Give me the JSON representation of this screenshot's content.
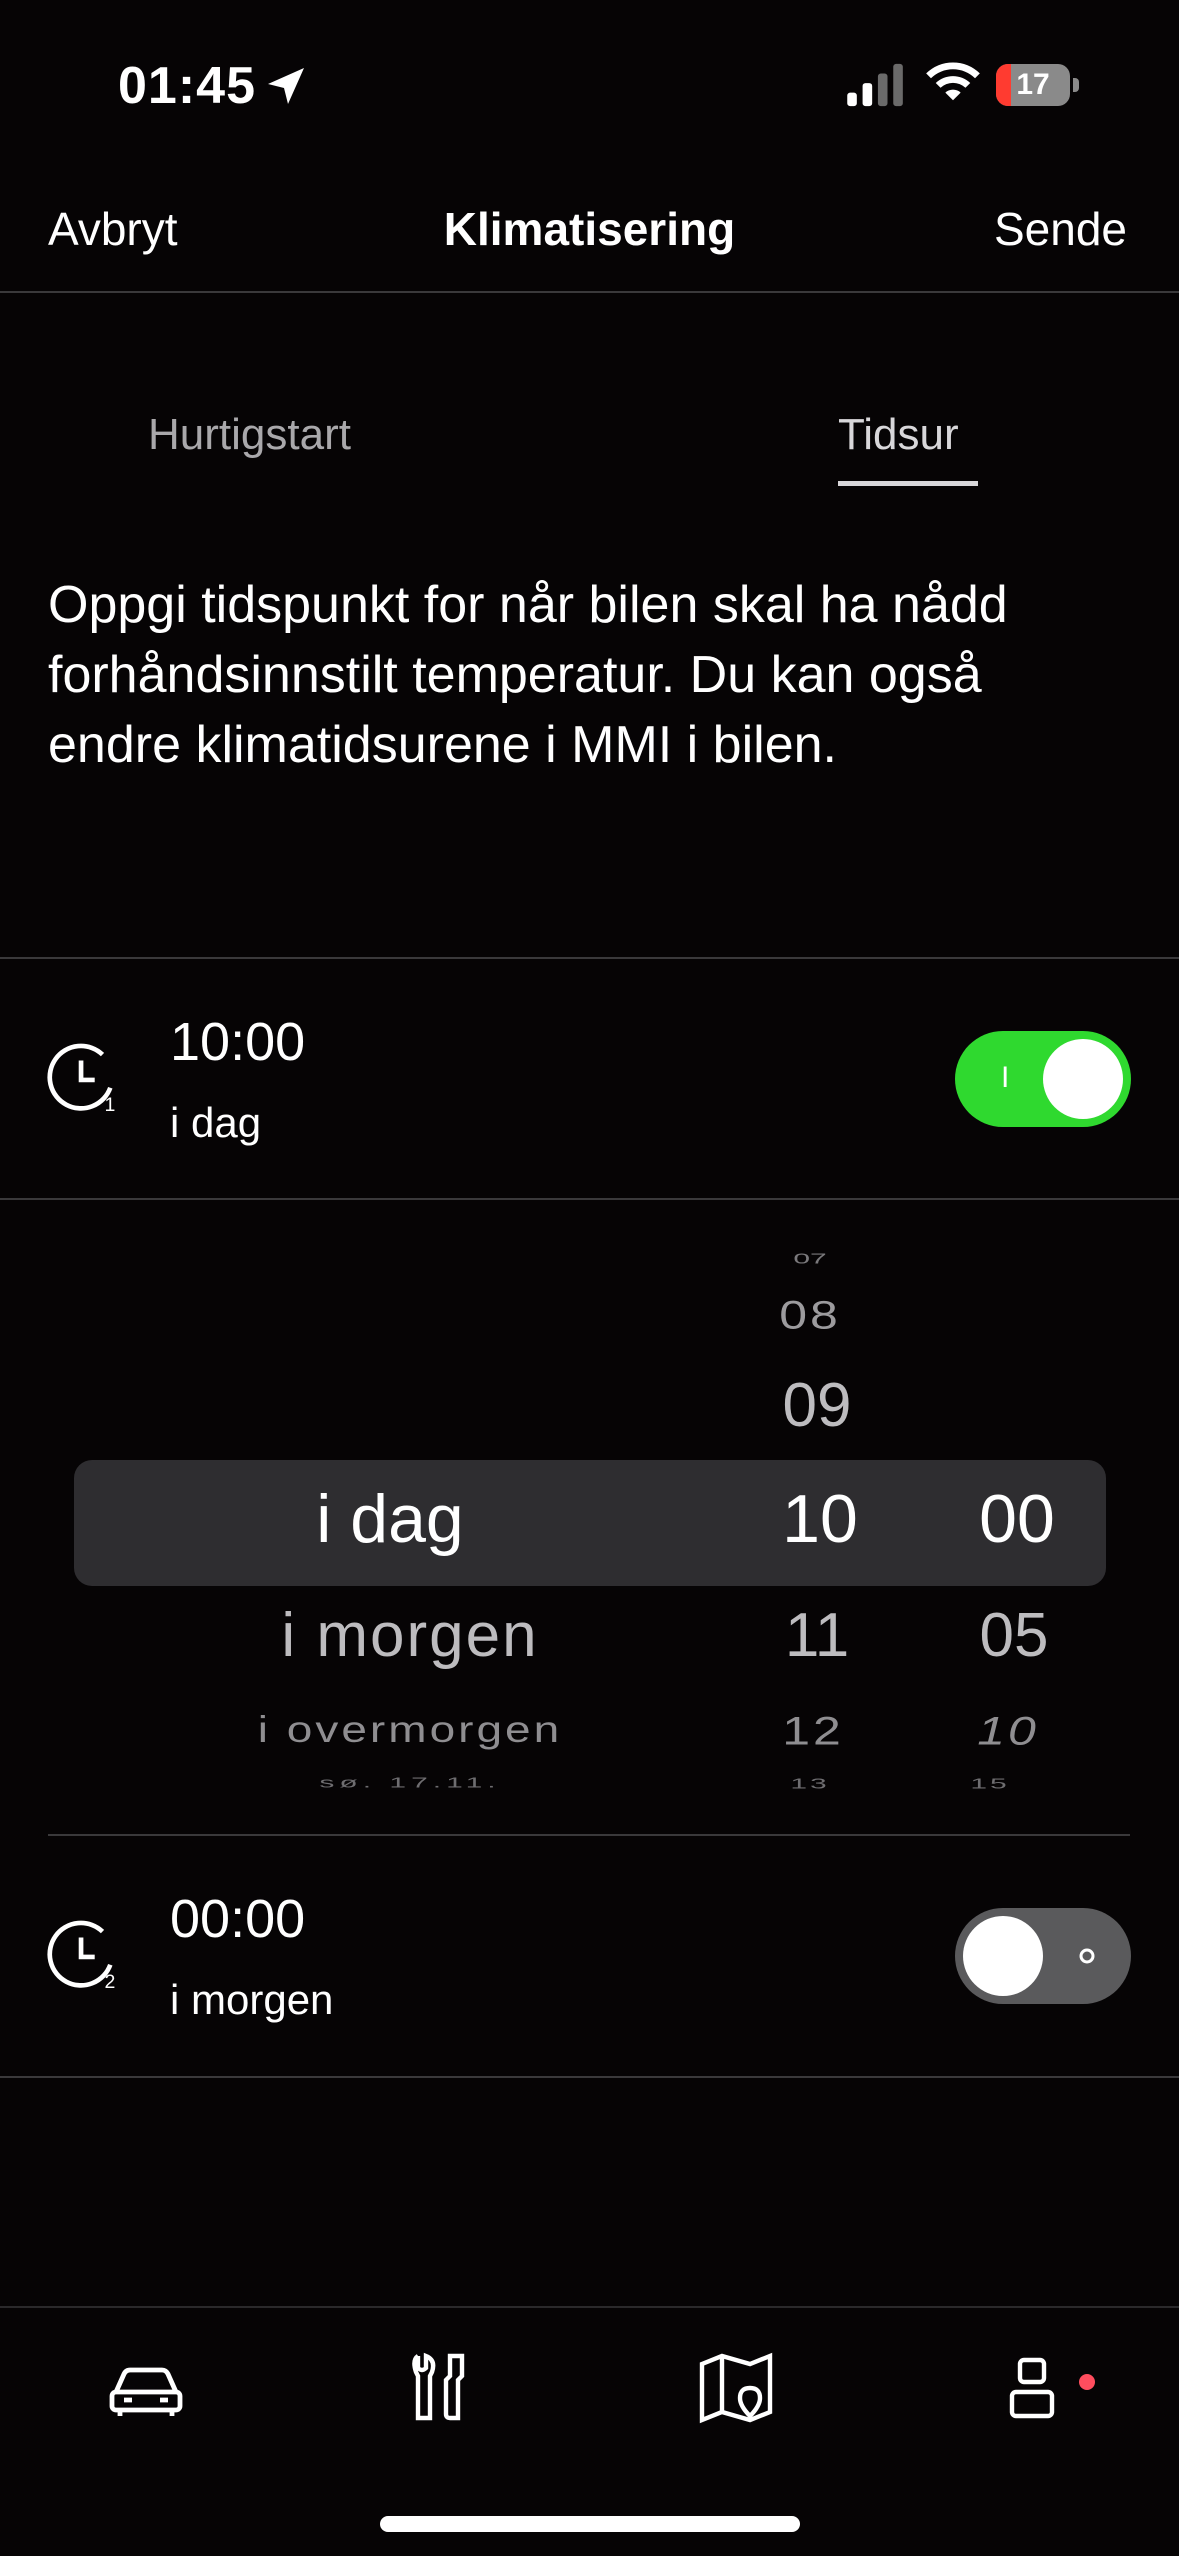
{
  "status_bar": {
    "time": "01:45",
    "battery": "17"
  },
  "header": {
    "cancel": "Avbryt",
    "title": "Klimatisering",
    "send": "Sende"
  },
  "tabs": [
    {
      "label": "Hurtigstart",
      "active": false
    },
    {
      "label": "Tidsur",
      "active": true
    }
  ],
  "description": "Oppgi tidspunkt for når bilen skal ha nådd forhåndsinnstilt temperatur. Du kan også endre klimatidsurene i MMI i bilen.",
  "timers": [
    {
      "index": "1",
      "time": "10:00",
      "day": "i dag",
      "enabled": true,
      "toggle_mark": "I"
    },
    {
      "index": "2",
      "time": "00:00",
      "day": "i morgen",
      "enabled": false,
      "toggle_mark": "O"
    }
  ],
  "picker": {
    "days": [
      "i dag",
      "i morgen",
      "i overmorgen",
      "sø. 17.11."
    ],
    "hours": [
      "07",
      "08",
      "09",
      "10",
      "11",
      "12",
      "13"
    ],
    "minutes": [
      "00",
      "05",
      "10",
      "15"
    ],
    "selected": {
      "day": "i dag",
      "hour": "10",
      "minute": "00"
    }
  },
  "colors": {
    "background": "#060405",
    "toggle_on": "#2fd92f",
    "toggle_off": "#5a5a5c",
    "notification_dot": "#ff4d5e"
  },
  "bottom_nav": [
    {
      "icon": "car-icon"
    },
    {
      "icon": "tools-icon"
    },
    {
      "icon": "map-icon"
    },
    {
      "icon": "profile-icon",
      "notification": true
    }
  ]
}
